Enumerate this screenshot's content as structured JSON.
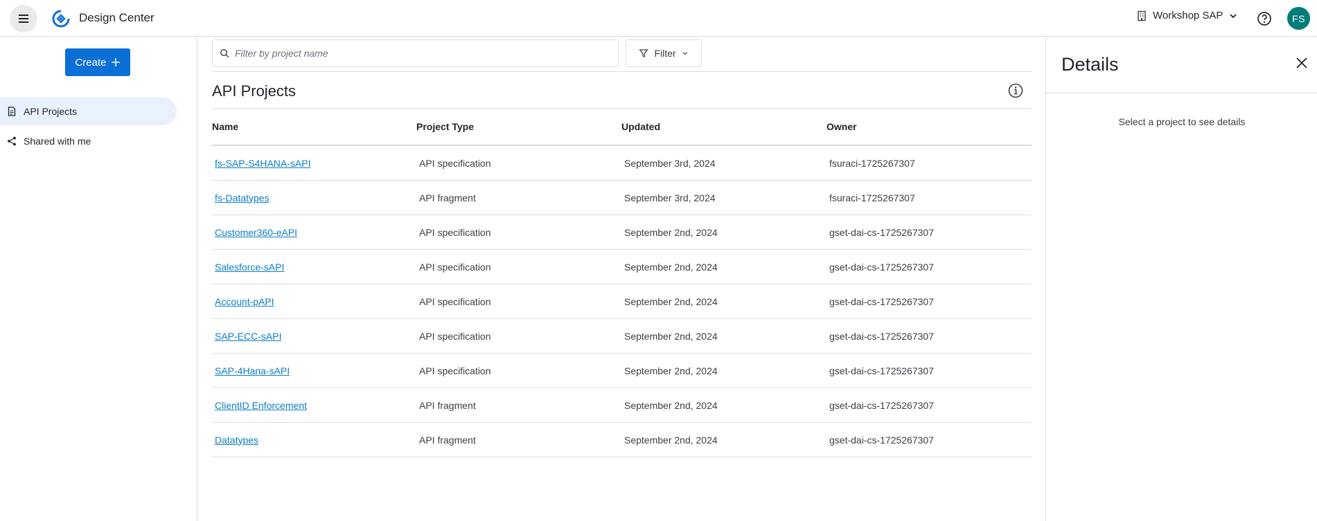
{
  "header": {
    "app_title": "Design Center",
    "org_name": "Workshop SAP",
    "avatar_initials": "FS",
    "brand_color": "#0b6fd6",
    "avatar_color": "#007c7a",
    "icons": {
      "menu": "hamburger-icon",
      "logo": "design-center-logo",
      "org": "building-icon",
      "org_chevron": "chevron-down-icon",
      "help": "help-icon"
    }
  },
  "sidebar": {
    "create_label": "Create",
    "items": [
      {
        "label": "API Projects",
        "icon": "document-icon",
        "active": true
      },
      {
        "label": "Shared with me",
        "icon": "share-icon",
        "active": false
      }
    ]
  },
  "main": {
    "search_placeholder": "Filter by project name",
    "filter_label": "Filter",
    "title": "API Projects",
    "columns": [
      "Name",
      "Project Type",
      "Updated",
      "Owner"
    ],
    "rows": [
      {
        "name": "fs-SAP-S4HANA-sAPI",
        "type": "API specification",
        "updated": "September 3rd, 2024",
        "owner": "fsuraci-1725267307"
      },
      {
        "name": "fs-Datatypes",
        "type": "API fragment",
        "updated": "September 3rd, 2024",
        "owner": "fsuraci-1725267307"
      },
      {
        "name": "Customer360-eAPI",
        "type": "API specification",
        "updated": "September 2nd, 2024",
        "owner": "gset-dai-cs-1725267307"
      },
      {
        "name": "Salesforce-sAPI",
        "type": "API specification",
        "updated": "September 2nd, 2024",
        "owner": "gset-dai-cs-1725267307"
      },
      {
        "name": "Account-pAPI",
        "type": "API specification",
        "updated": "September 2nd, 2024",
        "owner": "gset-dai-cs-1725267307"
      },
      {
        "name": "SAP-ECC-sAPI",
        "type": "API specification",
        "updated": "September 2nd, 2024",
        "owner": "gset-dai-cs-1725267307"
      },
      {
        "name": "SAP-4Hana-sAPI",
        "type": "API specification",
        "updated": "September 2nd, 2024",
        "owner": "gset-dai-cs-1725267307"
      },
      {
        "name": "ClientID Enforcement",
        "type": "API fragment",
        "updated": "September 2nd, 2024",
        "owner": "gset-dai-cs-1725267307"
      },
      {
        "name": "Datatypes",
        "type": "API fragment",
        "updated": "September 2nd, 2024",
        "owner": "gset-dai-cs-1725267307"
      }
    ]
  },
  "details": {
    "title": "Details",
    "empty_message": "Select a project to see details"
  }
}
